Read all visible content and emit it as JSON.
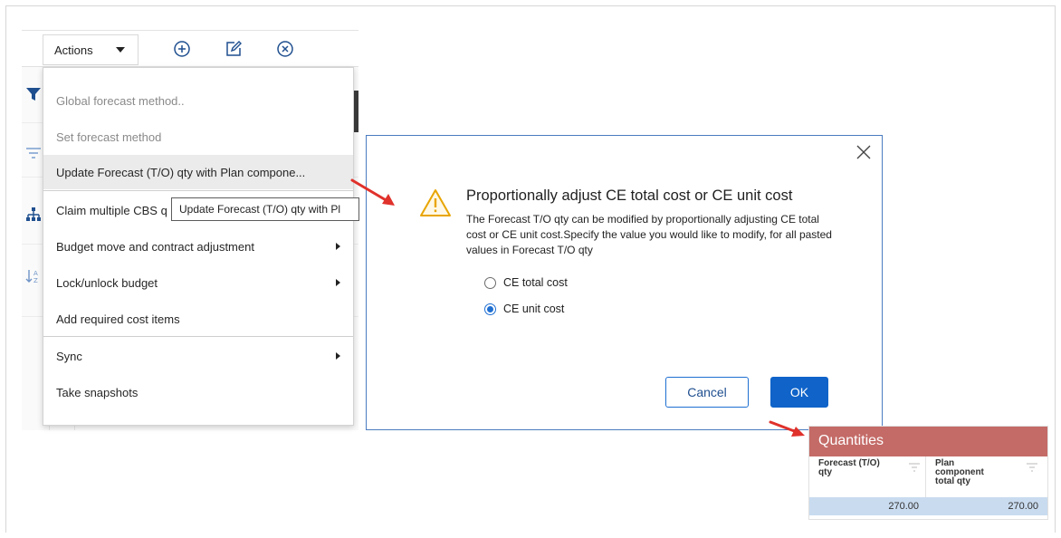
{
  "toolbar": {
    "actions_label": "Actions",
    "icons": [
      "add-circle-icon",
      "edit-icon",
      "close-circle-icon"
    ]
  },
  "menu": {
    "items": [
      {
        "label": "Global forecast method..",
        "disabled": true
      },
      {
        "label": "Set forecast method",
        "disabled": true
      },
      {
        "label": "Update Forecast (T/O) qty with Plan compone...",
        "highlighted": true
      },
      {
        "label": "Claim multiple CBS q"
      },
      {
        "label": "Budget move and contract adjustment",
        "submenu": true
      },
      {
        "label": "Lock/unlock budget",
        "submenu": true
      },
      {
        "label": "Add required cost items"
      },
      {
        "label": "Sync",
        "submenu": true
      },
      {
        "label": "Take snapshots"
      }
    ]
  },
  "tooltip": {
    "text": "Update Forecast (T/O) qty with Pl"
  },
  "dialog": {
    "title": "Proportionally adjust CE total cost or CE unit cost",
    "body": "The Forecast T/O qty can be modified by proportionally adjusting CE total cost or CE unit cost.Specify the value you would like to modify, for all pasted values in Forecast T/O qty",
    "options": [
      {
        "label": "CE total cost",
        "checked": false
      },
      {
        "label": "CE unit cost",
        "checked": true
      }
    ],
    "cancel_label": "Cancel",
    "ok_label": "OK"
  },
  "quantities": {
    "title": "Quantities",
    "columns": [
      {
        "label": "Forecast (T/O) qty",
        "value": "270.00"
      },
      {
        "label": "Plan component total qty",
        "value": "270.00"
      }
    ]
  },
  "colors": {
    "accent_blue": "#0f63c9",
    "quantities_header": "#c46b67",
    "selected_row": "#c9dbef",
    "arrow_red": "#e0312b"
  }
}
